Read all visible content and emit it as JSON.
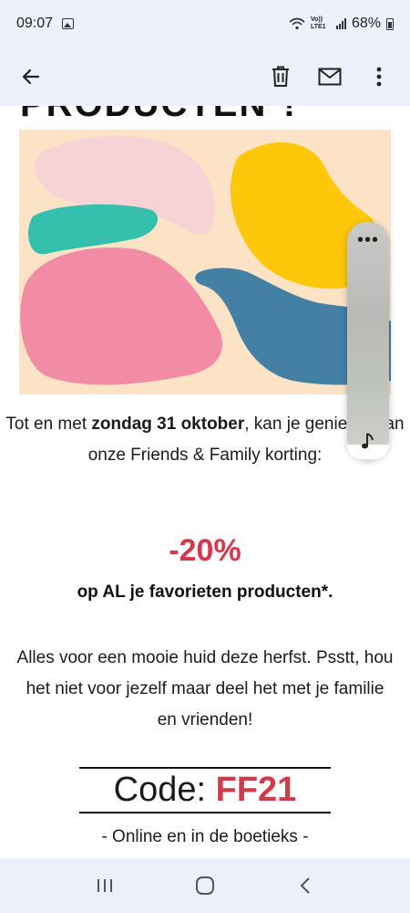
{
  "status_bar": {
    "time": "09:07",
    "network_label": "Vo)) LTE1",
    "battery": "68%"
  },
  "toolbar": {
    "back_icon": "arrow-left-icon",
    "delete_icon": "trash-icon",
    "mark_unread_icon": "envelope-icon",
    "more_icon": "more-vertical-icon"
  },
  "email": {
    "headline_fragment": "PRODUCTEN*!",
    "paragraph1": {
      "before": "Tot en met ",
      "bold": "zondag 31 oktober",
      "after": ", kan je genieten van onze Friends & Family korting:"
    },
    "discount": "-20%",
    "discount_sub": "op AL je favorieten producten*.",
    "paragraph2": "Alles voor een mooie huid deze herfst. Psstt, hou het niet voor jezelf maar deel het met je familie en vrienden!",
    "code_label": "Code: ",
    "code_value": "FF21",
    "channels": "- Online en in de boetieks -"
  },
  "floating_panel": {
    "more_icon": "more-horizontal-icon",
    "music_icon": "music-note-icon"
  },
  "navbar": {
    "recents_icon": "recents-icon",
    "home_icon": "home-icon",
    "back_icon": "chevron-left-icon"
  },
  "colors": {
    "accent_red": "#d23a4c",
    "chrome_bg": "#ecf0fa",
    "hero_bg": "#fde3c5",
    "blob_pink_light": "#f8d3d6",
    "blob_yellow": "#fdc80a",
    "blob_teal": "#34c0ad",
    "blob_pink": "#f28ba4",
    "blob_blue": "#447fa4"
  }
}
